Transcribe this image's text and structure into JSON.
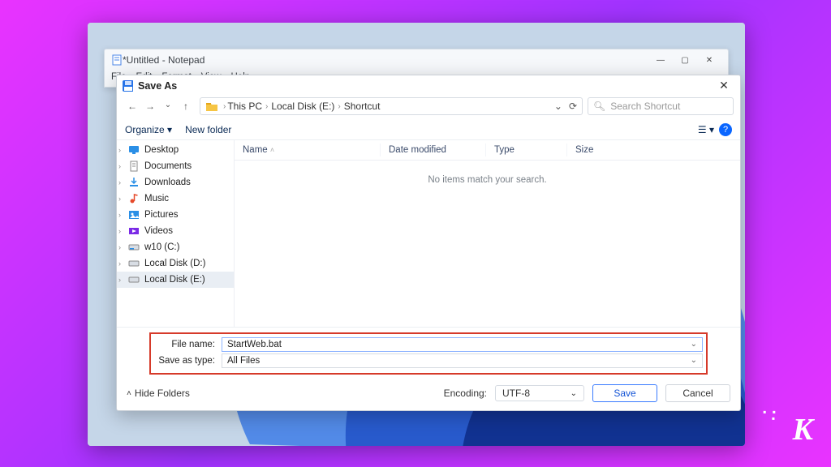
{
  "notepad": {
    "title": "*Untitled - Notepad",
    "menu": [
      "File",
      "Edit",
      "Format",
      "View",
      "Help"
    ]
  },
  "saveas": {
    "title": "Save As",
    "breadcrumb": [
      "This PC",
      "Local Disk (E:)",
      "Shortcut"
    ],
    "search_placeholder": "Search Shortcut",
    "organize": "Organize",
    "new_folder": "New folder",
    "columns": [
      "Name",
      "Date modified",
      "Type",
      "Size"
    ],
    "empty": "No items match your search.",
    "tree": [
      {
        "label": "Desktop",
        "icon": "desktop"
      },
      {
        "label": "Documents",
        "icon": "doc"
      },
      {
        "label": "Downloads",
        "icon": "download"
      },
      {
        "label": "Music",
        "icon": "music"
      },
      {
        "label": "Pictures",
        "icon": "pictures"
      },
      {
        "label": "Videos",
        "icon": "videos"
      },
      {
        "label": "w10 (C:)",
        "icon": "disk"
      },
      {
        "label": "Local Disk (D:)",
        "icon": "disk"
      },
      {
        "label": "Local Disk (E:)",
        "icon": "disk",
        "selected": true
      }
    ],
    "filename_label": "File name:",
    "filename_value": "StartWeb.bat",
    "type_label": "Save as type:",
    "type_value": "All Files",
    "hide_folders": "Hide Folders",
    "encoding_label": "Encoding:",
    "encoding_value": "UTF-8",
    "save": "Save",
    "cancel": "Cancel"
  }
}
